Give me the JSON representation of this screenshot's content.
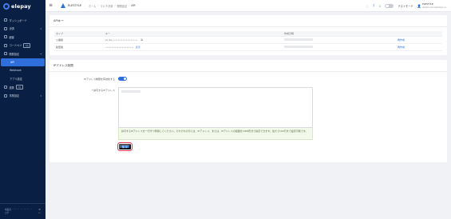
{
  "app": {
    "logo_text": "elepay"
  },
  "sidebar": {
    "items": [
      {
        "label": "ダッシュボード",
        "icon": "dashboard-icon"
      },
      {
        "label": "決済",
        "icon": "payment-icon",
        "expandable": true
      },
      {
        "label": "顧客",
        "icon": "customer-icon"
      },
      {
        "label": "コードペイ",
        "icon": "codepay-icon",
        "badge": "β版"
      },
      {
        "label": "開発設定",
        "icon": "developer-icon",
        "expandable": true,
        "expanded": true
      },
      {
        "label": "API",
        "sub": true,
        "active": true
      },
      {
        "label": "Webhook",
        "sub": true
      },
      {
        "label": "アプリ設定",
        "sub": true
      },
      {
        "label": "連携",
        "icon": "integration-icon",
        "badge": "β版"
      },
      {
        "label": "事業設定",
        "icon": "business-settings-icon",
        "expandable": true
      }
    ],
    "footer": {
      "line1": "事業者 ・・・・・・・・・・",
      "line2": "ログ"
    }
  },
  "header": {
    "merchant_name": "ELESTYLE",
    "breadcrumb": [
      "ホーム",
      "マルチ決済",
      "開発設定",
      "API"
    ],
    "test_mode_label": "テストモード",
    "user_name": "ELESTYLE",
    "user_sub": "elestyle-xxxxx@elestyle.xx..."
  },
  "api_card": {
    "title": "APIキー",
    "columns": [
      "タイプ",
      "キー",
      "作成日時",
      ""
    ],
    "rows": [
      {
        "type": "公開鍵",
        "key": "pk_live_•••••••••••••••••••••",
        "action": "再作成",
        "has_copy": true
      },
      {
        "type": "秘密鍵",
        "key": "••••••••••••••••••••••••",
        "show_label": "表示",
        "action": "再作成"
      }
    ]
  },
  "ip_card": {
    "title": "IPアドレス制限",
    "enable_label": "IPアドレス制限を有効化する",
    "allowed_label": "* 許可するIPアドレス",
    "note": "許可するIPアドレスを一行ずつ登録してください。それぞれの行には、IPアドレス、または、IPアドレスの範囲をCIDR形式で指定できます。最大で100行まで設定可能です。",
    "save_label": "保 存"
  }
}
